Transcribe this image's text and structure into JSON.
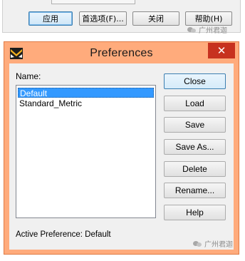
{
  "background_dialog": {
    "buttons": [
      {
        "label": "应用"
      },
      {
        "label": "首选项(F)..."
      },
      {
        "label": "关闭"
      },
      {
        "label": "帮助(H)"
      }
    ],
    "watermark": "广州君迦"
  },
  "preferences_dialog": {
    "title": "Preferences",
    "close_glyph": "✕",
    "name_label": "Name:",
    "preferences": [
      {
        "label": "Default",
        "selected": true
      },
      {
        "label": "Standard_Metric",
        "selected": false
      }
    ],
    "buttons": [
      {
        "label": "Close"
      },
      {
        "label": "Load"
      },
      {
        "label": "Save"
      },
      {
        "label": "Save As..."
      },
      {
        "label": "Delete"
      },
      {
        "label": "Rename..."
      },
      {
        "label": "Help"
      }
    ],
    "status_text": "Active Preference: Default",
    "watermark": "广州君迦"
  },
  "colors": {
    "dialog_frame": "#ffab7c",
    "close_button": "#c7311f",
    "selection": "#3399ff",
    "client_bg": "#f0f0f0"
  },
  "icons": {
    "app_icon": "app-logo-icon",
    "close": "close-icon",
    "watermark_logo": "wechat-logo-icon"
  }
}
